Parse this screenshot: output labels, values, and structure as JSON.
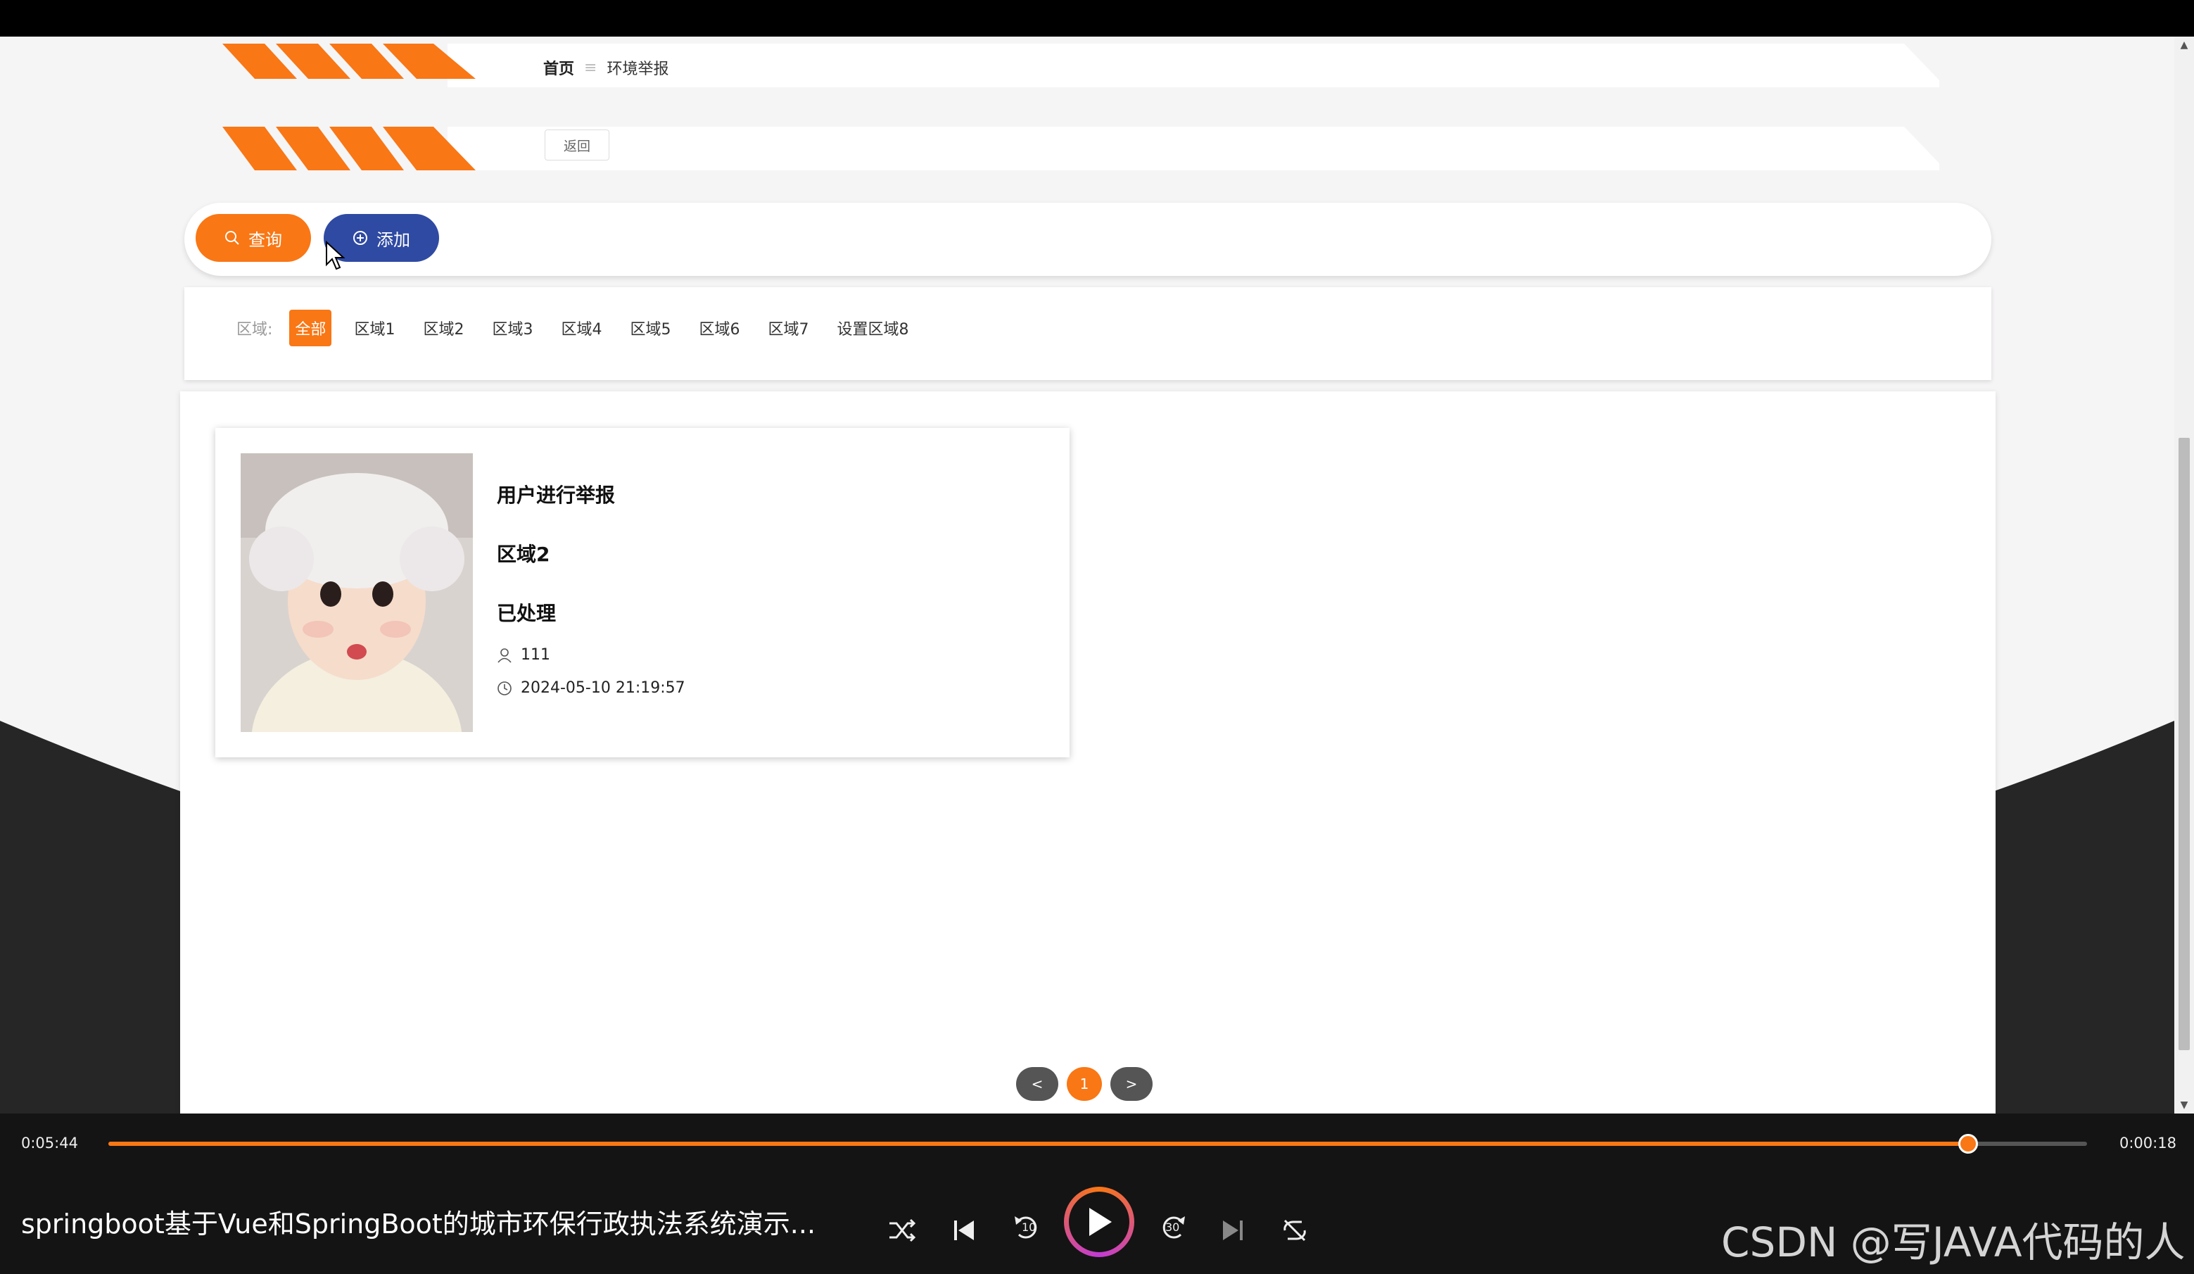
{
  "breadcrumb": {
    "home": "首页",
    "separator": "≡",
    "current": "环境举报"
  },
  "back_label": "返回",
  "actions": {
    "query_label": "查询",
    "add_label": "添加"
  },
  "filter": {
    "label": "区域:",
    "options": [
      "全部",
      "区域1",
      "区域2",
      "区域3",
      "区域4",
      "区域5",
      "区域6",
      "区域7",
      "设置区域8"
    ],
    "active": "全部"
  },
  "card": {
    "title": "用户进行举报",
    "area": "区域2",
    "status": "已处理",
    "user": "111",
    "time": "2024-05-10 21:19:57"
  },
  "pager": {
    "prev": "<",
    "current": "1",
    "next": ">"
  },
  "player": {
    "elapsed": "0:05:44",
    "remaining": "0:00:18",
    "progress": 0.94,
    "title": "springboot基于Vue和SpringBoot的城市环保行政执法系统演示...",
    "skip_back_label": "10",
    "skip_forward_label": "30"
  },
  "watermark": "CSDN @写JAVA代码的人",
  "colors": {
    "accent": "#f97715",
    "add_button": "#2f4aa2"
  }
}
